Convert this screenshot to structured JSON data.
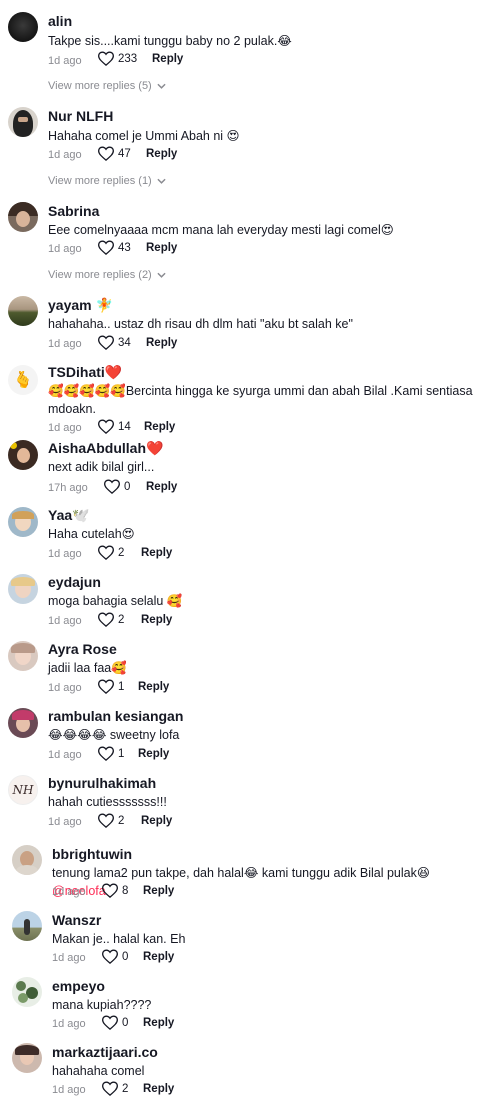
{
  "comments": [
    {
      "username": "alin",
      "text": "Takpe sis....kami tunggu baby no 2 pulak.😂",
      "time": "1d ago",
      "likes": "233",
      "reply": "Reply",
      "view_more": "View more replies (5)"
    },
    {
      "username": "Nur NLFH",
      "text": "Hahaha comel je Ummi Abah ni 😍",
      "time": "1d ago",
      "likes": "47",
      "reply": "Reply",
      "view_more": "View more replies (1)"
    },
    {
      "username": "Sabrina",
      "text": "Eee comelnyaaaa mcm mana lah everyday mesti lagi comel😍",
      "time": "1d ago",
      "likes": "43",
      "reply": "Reply",
      "view_more": "View more replies (2)"
    },
    {
      "username": "yayam 🧚",
      "text": "hahahaha.. ustaz dh risau dh dlm hati \"aku bt salah ke\"",
      "time": "1d ago",
      "likes": "34",
      "reply": "Reply"
    },
    {
      "username": "TSDihati❤️",
      "text": "🥰🥰🥰🥰🥰Bercinta hingga ke syurga ummi dan abah Bilal .Kami sentiasa mdoakn.",
      "time": "1d ago",
      "likes": "14",
      "reply": "Reply"
    },
    {
      "username": "AishaAbdullah❤️",
      "text": "next adik bilal girl...",
      "time": "17h ago",
      "likes": "0",
      "reply": "Reply"
    },
    {
      "username": "Yaa🕊️",
      "text": "Haha cutelah😍",
      "time": "1d ago",
      "likes": "2",
      "reply": "Reply"
    },
    {
      "username": "eydajun",
      "text": "moga bahagia selalu 🥰",
      "time": "1d ago",
      "likes": "2",
      "reply": "Reply"
    },
    {
      "username": "Ayra Rose",
      "text": "jadii laa faa🥰",
      "time": "1d ago",
      "likes": "1",
      "reply": "Reply"
    },
    {
      "username": "rambulan kesiangan",
      "text": "😂😂😂😂 sweetny lofa",
      "time": "1d ago",
      "likes": "1",
      "reply": "Reply"
    },
    {
      "username": "bynurulhakimah",
      "text": "hahah cutiesssssss!!!",
      "time": "1d ago",
      "likes": "2",
      "reply": "Reply",
      "avatar_text": "NH"
    },
    {
      "username": "bbrightuwin",
      "text": "tenung lama2 pun takpe, dah halal😂 kami tunggu adik Bilal pulak😆 ",
      "mention": "@neelofa",
      "time": "1d ago",
      "likes": "8",
      "reply": "Reply"
    },
    {
      "username": "Wanszr",
      "text": "Makan je.. halal kan. Eh",
      "time": "1d ago",
      "likes": "0",
      "reply": "Reply"
    },
    {
      "username": "empeyo",
      "text": "mana kupiah????",
      "time": "1d ago",
      "likes": "0",
      "reply": "Reply"
    },
    {
      "username": "markaztijaari.co",
      "text": "hahahaha comel",
      "time": "1d ago",
      "likes": "2",
      "reply": "Reply"
    }
  ],
  "colors": {
    "mention": "#fe2c55",
    "muted": "#8a8b91",
    "text": "#161823"
  },
  "icons": {
    "like": "heart-outline-icon",
    "expand": "chevron-down-icon"
  }
}
